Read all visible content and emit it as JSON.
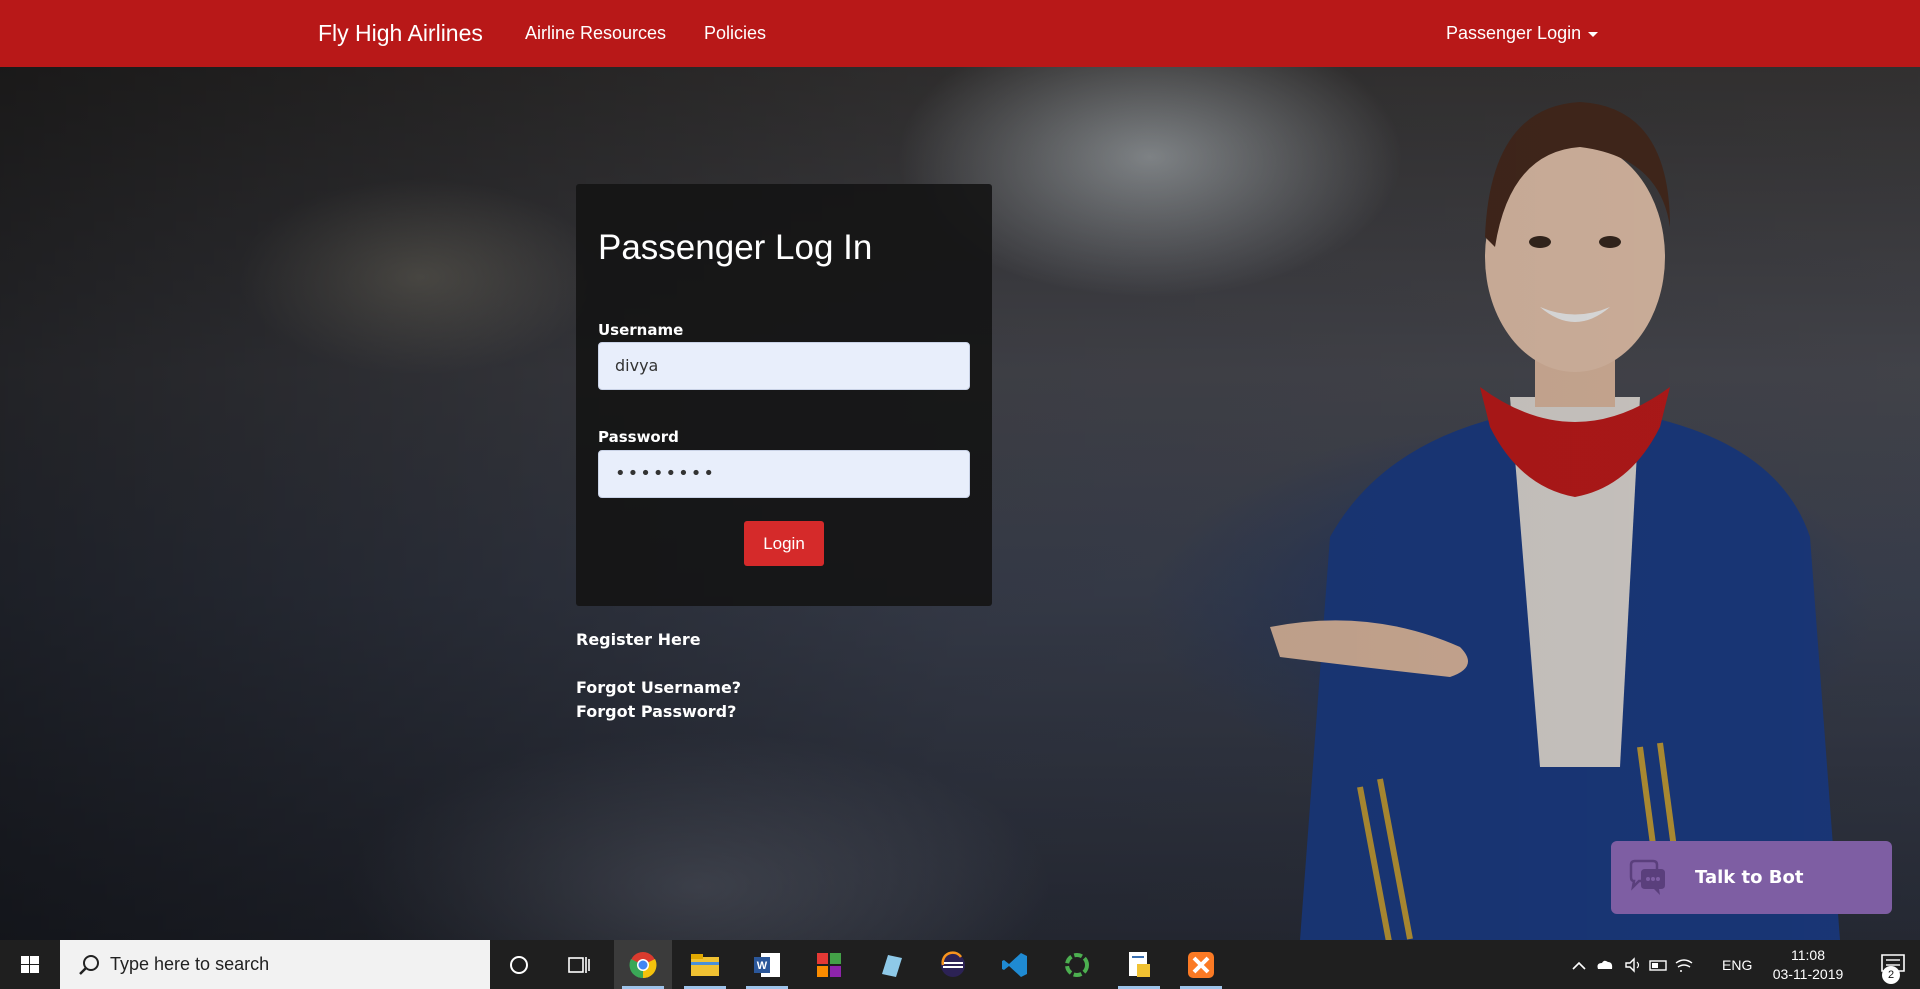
{
  "navbar": {
    "brand": "Fly High Airlines",
    "links": [
      "Airline Resources",
      "Policies"
    ],
    "account_menu": "Passenger Login",
    "background_color": "#b81818"
  },
  "login": {
    "title": "Passenger Log In",
    "username_label": "Username",
    "username_value": "divya",
    "password_label": "Password",
    "password_value": "••••••••",
    "submit_label": "Login",
    "submit_color": "#d52a2a"
  },
  "links": {
    "register": "Register Here",
    "forgot_username": "Forgot Username?",
    "forgot_password": "Forgot Password?"
  },
  "bot": {
    "label": "Talk to Bot",
    "icon": "chat-bubbles-icon",
    "color": "#7e5ea3"
  },
  "taskbar": {
    "search_placeholder": "Type here to search",
    "pinned_apps": [
      "cortana-icon",
      "task-view-icon",
      "chrome-icon",
      "file-explorer-icon",
      "word-icon",
      "app-grid-icon",
      "notepad-icon",
      "eclipse-icon",
      "vscode-icon",
      "circle-app-icon",
      "python-file-icon",
      "xampp-icon"
    ],
    "language": "ENG",
    "time": "11:08",
    "date": "03-11-2019",
    "notification_count": "2"
  }
}
